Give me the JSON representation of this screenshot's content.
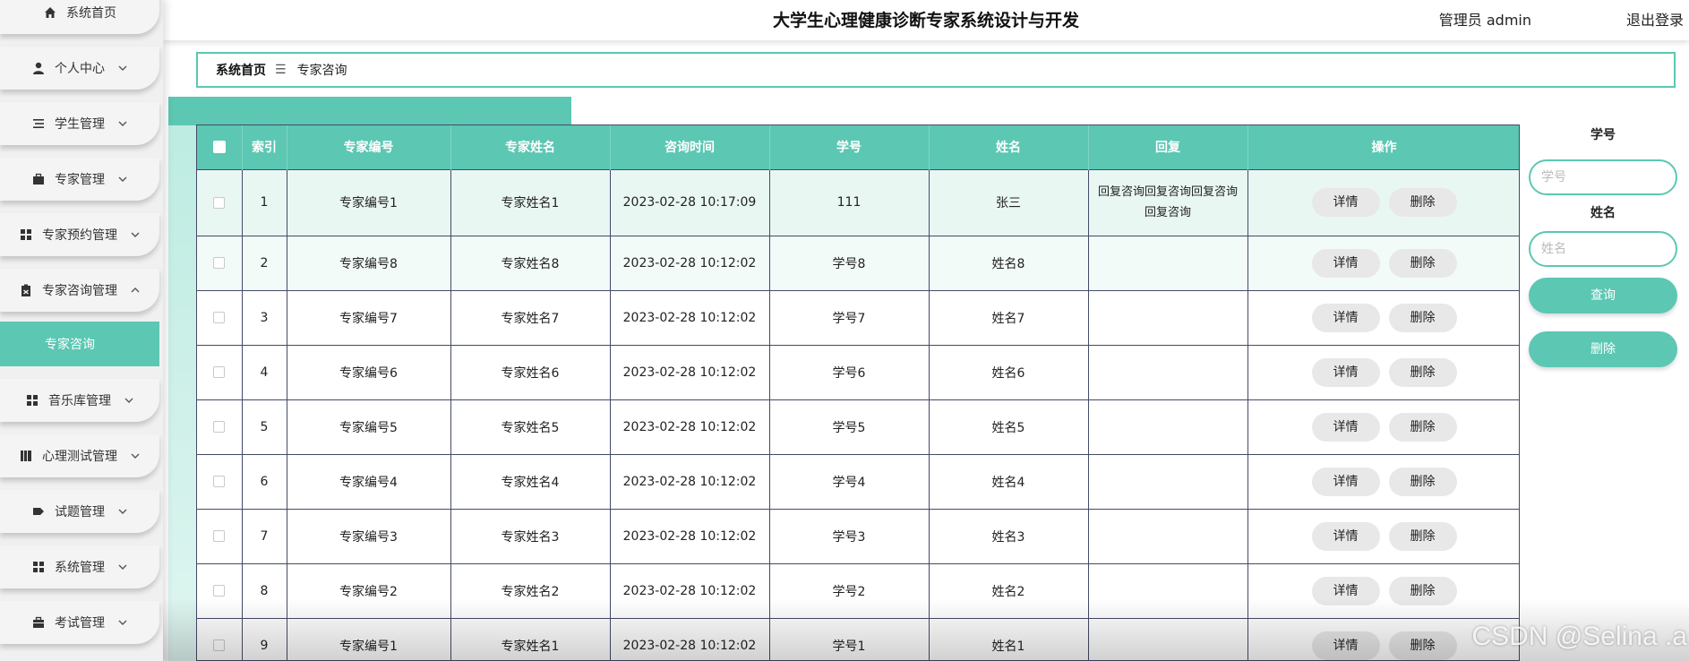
{
  "colors": {
    "accent": "#5cc7b3",
    "row_border": "#444a66"
  },
  "header": {
    "title": "大学生心理健康诊断专家系统设计与开发",
    "user": "管理员 admin",
    "logout": "退出登录"
  },
  "sidebar": {
    "items": [
      {
        "label": "系统首页",
        "icon": "home-icon"
      },
      {
        "label": "个人中心",
        "icon": "user-icon"
      },
      {
        "label": "学生管理",
        "icon": "list-icon"
      },
      {
        "label": "专家管理",
        "icon": "briefcase-icon"
      },
      {
        "label": "专家预约管理",
        "icon": "grid-icon"
      },
      {
        "label": "专家咨询管理",
        "icon": "clipboard-icon"
      },
      {
        "label": "音乐库管理",
        "icon": "grid-icon"
      },
      {
        "label": "心理测试管理",
        "icon": "book-icon"
      },
      {
        "label": "试题管理",
        "icon": "tag-icon"
      },
      {
        "label": "系统管理",
        "icon": "grid-icon"
      },
      {
        "label": "考试管理",
        "icon": "bag-icon"
      }
    ],
    "active_sub": "专家咨询"
  },
  "breadcrumb": {
    "home": "系统首页",
    "sep": "☰",
    "current": "专家咨询"
  },
  "table": {
    "headers": [
      "索引",
      "专家编号",
      "专家姓名",
      "咨询时间",
      "学号",
      "姓名",
      "回复",
      "操作"
    ],
    "rows": [
      {
        "index": "1",
        "expert_no": "专家编号1",
        "expert_name": "专家姓名1",
        "time": "2023-02-28 10:17:09",
        "student_no": "111",
        "name": "张三",
        "reply": "回复咨询回复咨询回复咨询回复咨询"
      },
      {
        "index": "2",
        "expert_no": "专家编号8",
        "expert_name": "专家姓名8",
        "time": "2023-02-28 10:12:02",
        "student_no": "学号8",
        "name": "姓名8",
        "reply": ""
      },
      {
        "index": "3",
        "expert_no": "专家编号7",
        "expert_name": "专家姓名7",
        "time": "2023-02-28 10:12:02",
        "student_no": "学号7",
        "name": "姓名7",
        "reply": ""
      },
      {
        "index": "4",
        "expert_no": "专家编号6",
        "expert_name": "专家姓名6",
        "time": "2023-02-28 10:12:02",
        "student_no": "学号6",
        "name": "姓名6",
        "reply": ""
      },
      {
        "index": "5",
        "expert_no": "专家编号5",
        "expert_name": "专家姓名5",
        "time": "2023-02-28 10:12:02",
        "student_no": "学号5",
        "name": "姓名5",
        "reply": ""
      },
      {
        "index": "6",
        "expert_no": "专家编号4",
        "expert_name": "专家姓名4",
        "time": "2023-02-28 10:12:02",
        "student_no": "学号4",
        "name": "姓名4",
        "reply": ""
      },
      {
        "index": "7",
        "expert_no": "专家编号3",
        "expert_name": "专家姓名3",
        "time": "2023-02-28 10:12:02",
        "student_no": "学号3",
        "name": "姓名3",
        "reply": ""
      },
      {
        "index": "8",
        "expert_no": "专家编号2",
        "expert_name": "专家姓名2",
        "time": "2023-02-28 10:12:02",
        "student_no": "学号2",
        "name": "姓名2",
        "reply": ""
      },
      {
        "index": "9",
        "expert_no": "专家编号1",
        "expert_name": "专家姓名1",
        "time": "2023-02-28 10:12:02",
        "student_no": "学号1",
        "name": "姓名1",
        "reply": ""
      }
    ],
    "detail_label": "详情",
    "delete_label": "删除"
  },
  "search": {
    "student_no_label": "学号",
    "student_no_placeholder": "学号",
    "name_label": "姓名",
    "name_placeholder": "姓名",
    "query_label": "查询",
    "delete_label": "删除"
  },
  "watermark": "CSDN @Selina .a"
}
